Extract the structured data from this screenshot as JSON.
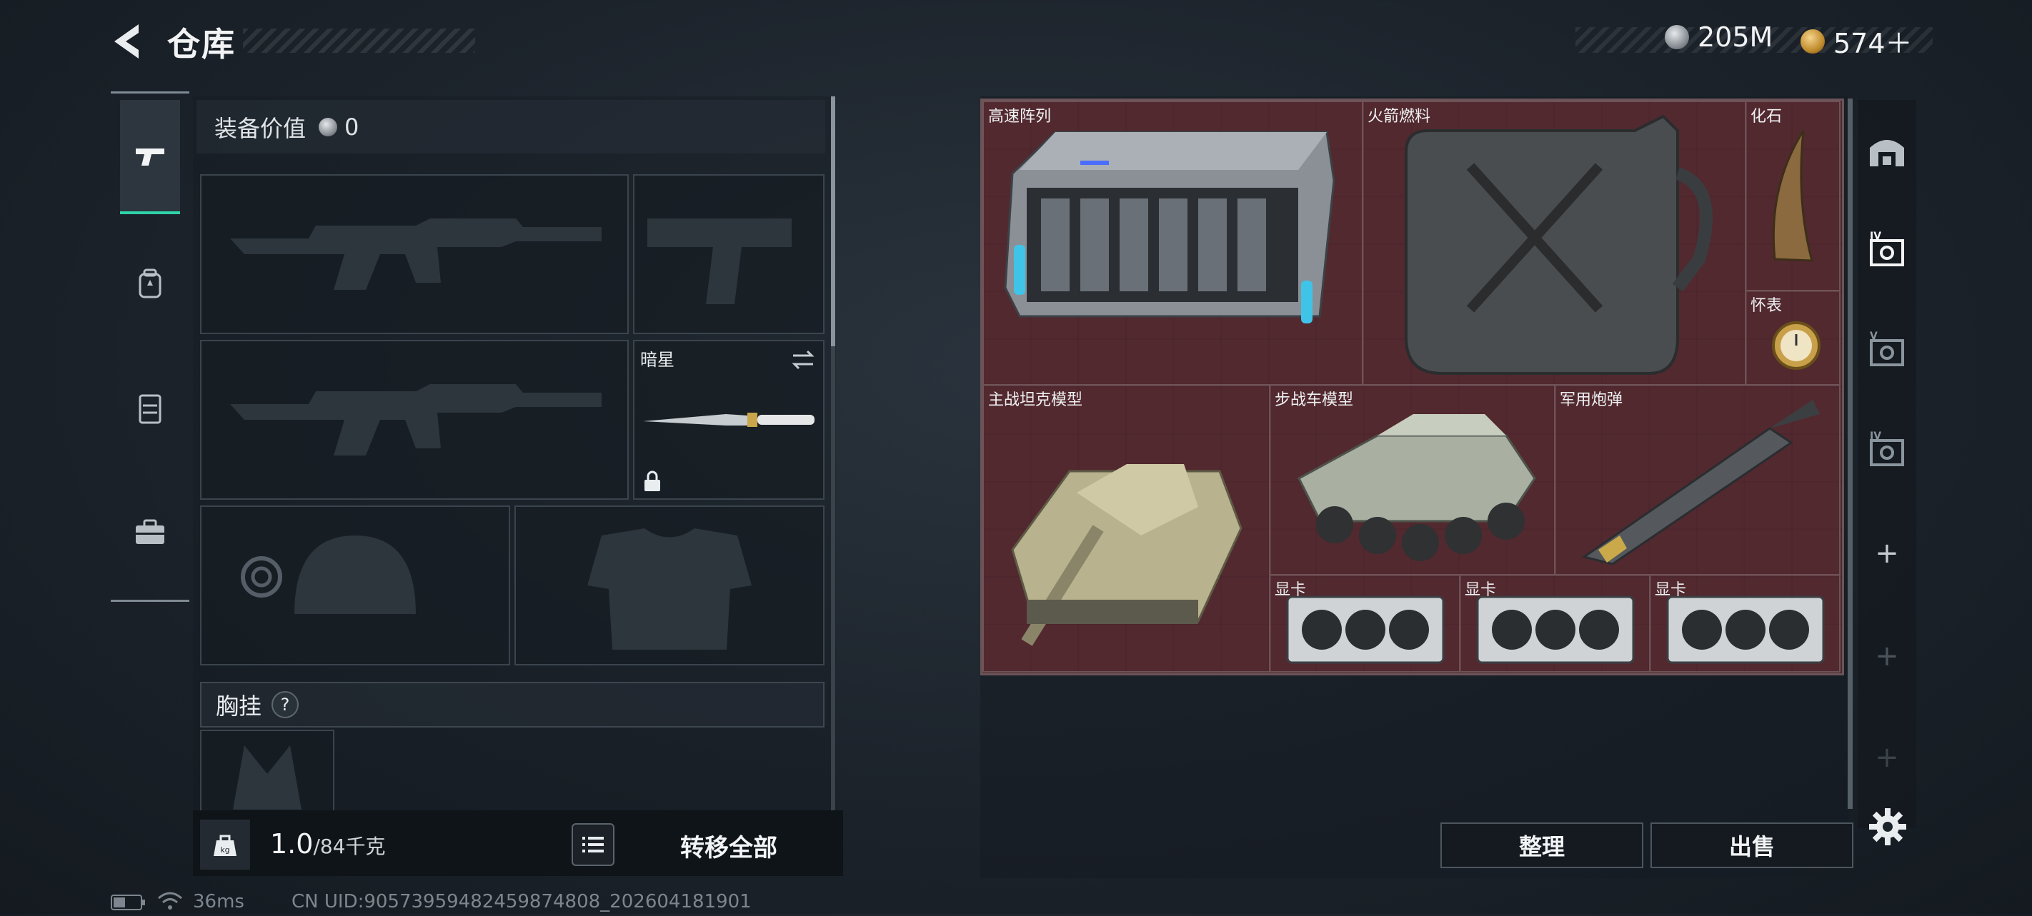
{
  "header": {
    "title": "仓库",
    "currency_silver": "205M",
    "currency_gold": "574＋"
  },
  "left_tabs": [
    "firearms",
    "backpack",
    "vest",
    "briefcase"
  ],
  "equipment": {
    "value_label": "装备价值",
    "value": "0",
    "melee_name": "暗星",
    "chest_label": "胸挂",
    "help_symbol": "?"
  },
  "footer": {
    "weight_icon_text": "kg",
    "weight_current": "1.0",
    "weight_capacity": "/84千克",
    "transfer_all": "转移全部"
  },
  "status_bar": {
    "ping": "36ms",
    "uid": "CN UID:9057395948245987480​8_202604181901"
  },
  "storage": {
    "items": [
      {
        "name": "高速阵列"
      },
      {
        "name": "火箭燃料"
      },
      {
        "name": "化石"
      },
      {
        "name": "怀表"
      },
      {
        "name": "主战坦克模型"
      },
      {
        "name": "步战车模型"
      },
      {
        "name": "军用炮弹"
      },
      {
        "name": "显卡"
      },
      {
        "name": "显卡"
      },
      {
        "name": "显卡"
      }
    ],
    "organize": "整理",
    "sell": "出售"
  },
  "side_rail": {
    "tabs": [
      "IV",
      "V",
      "IV"
    ],
    "plus": "+"
  },
  "colors": {
    "accent": "#2fd3a8",
    "storage_bg": "#4a2a30",
    "panel_border": "#3b444d"
  }
}
